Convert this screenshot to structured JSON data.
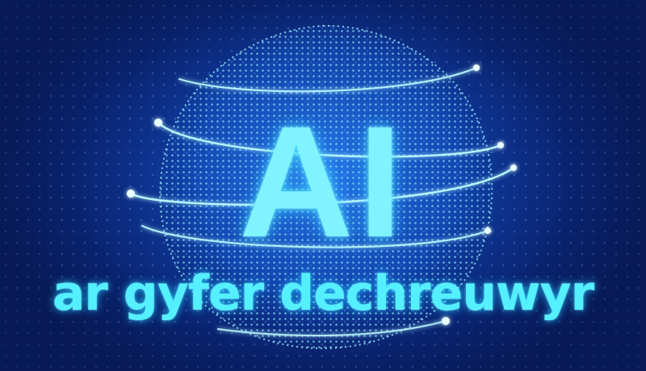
{
  "heading": "AI",
  "subheading": "ar gyfer dechreuwyr",
  "colors": {
    "background": "#0a1f5c",
    "glow": "#55f0ff",
    "accent": "#7ff3ff"
  },
  "graphic": "dotted-sphere-icon"
}
